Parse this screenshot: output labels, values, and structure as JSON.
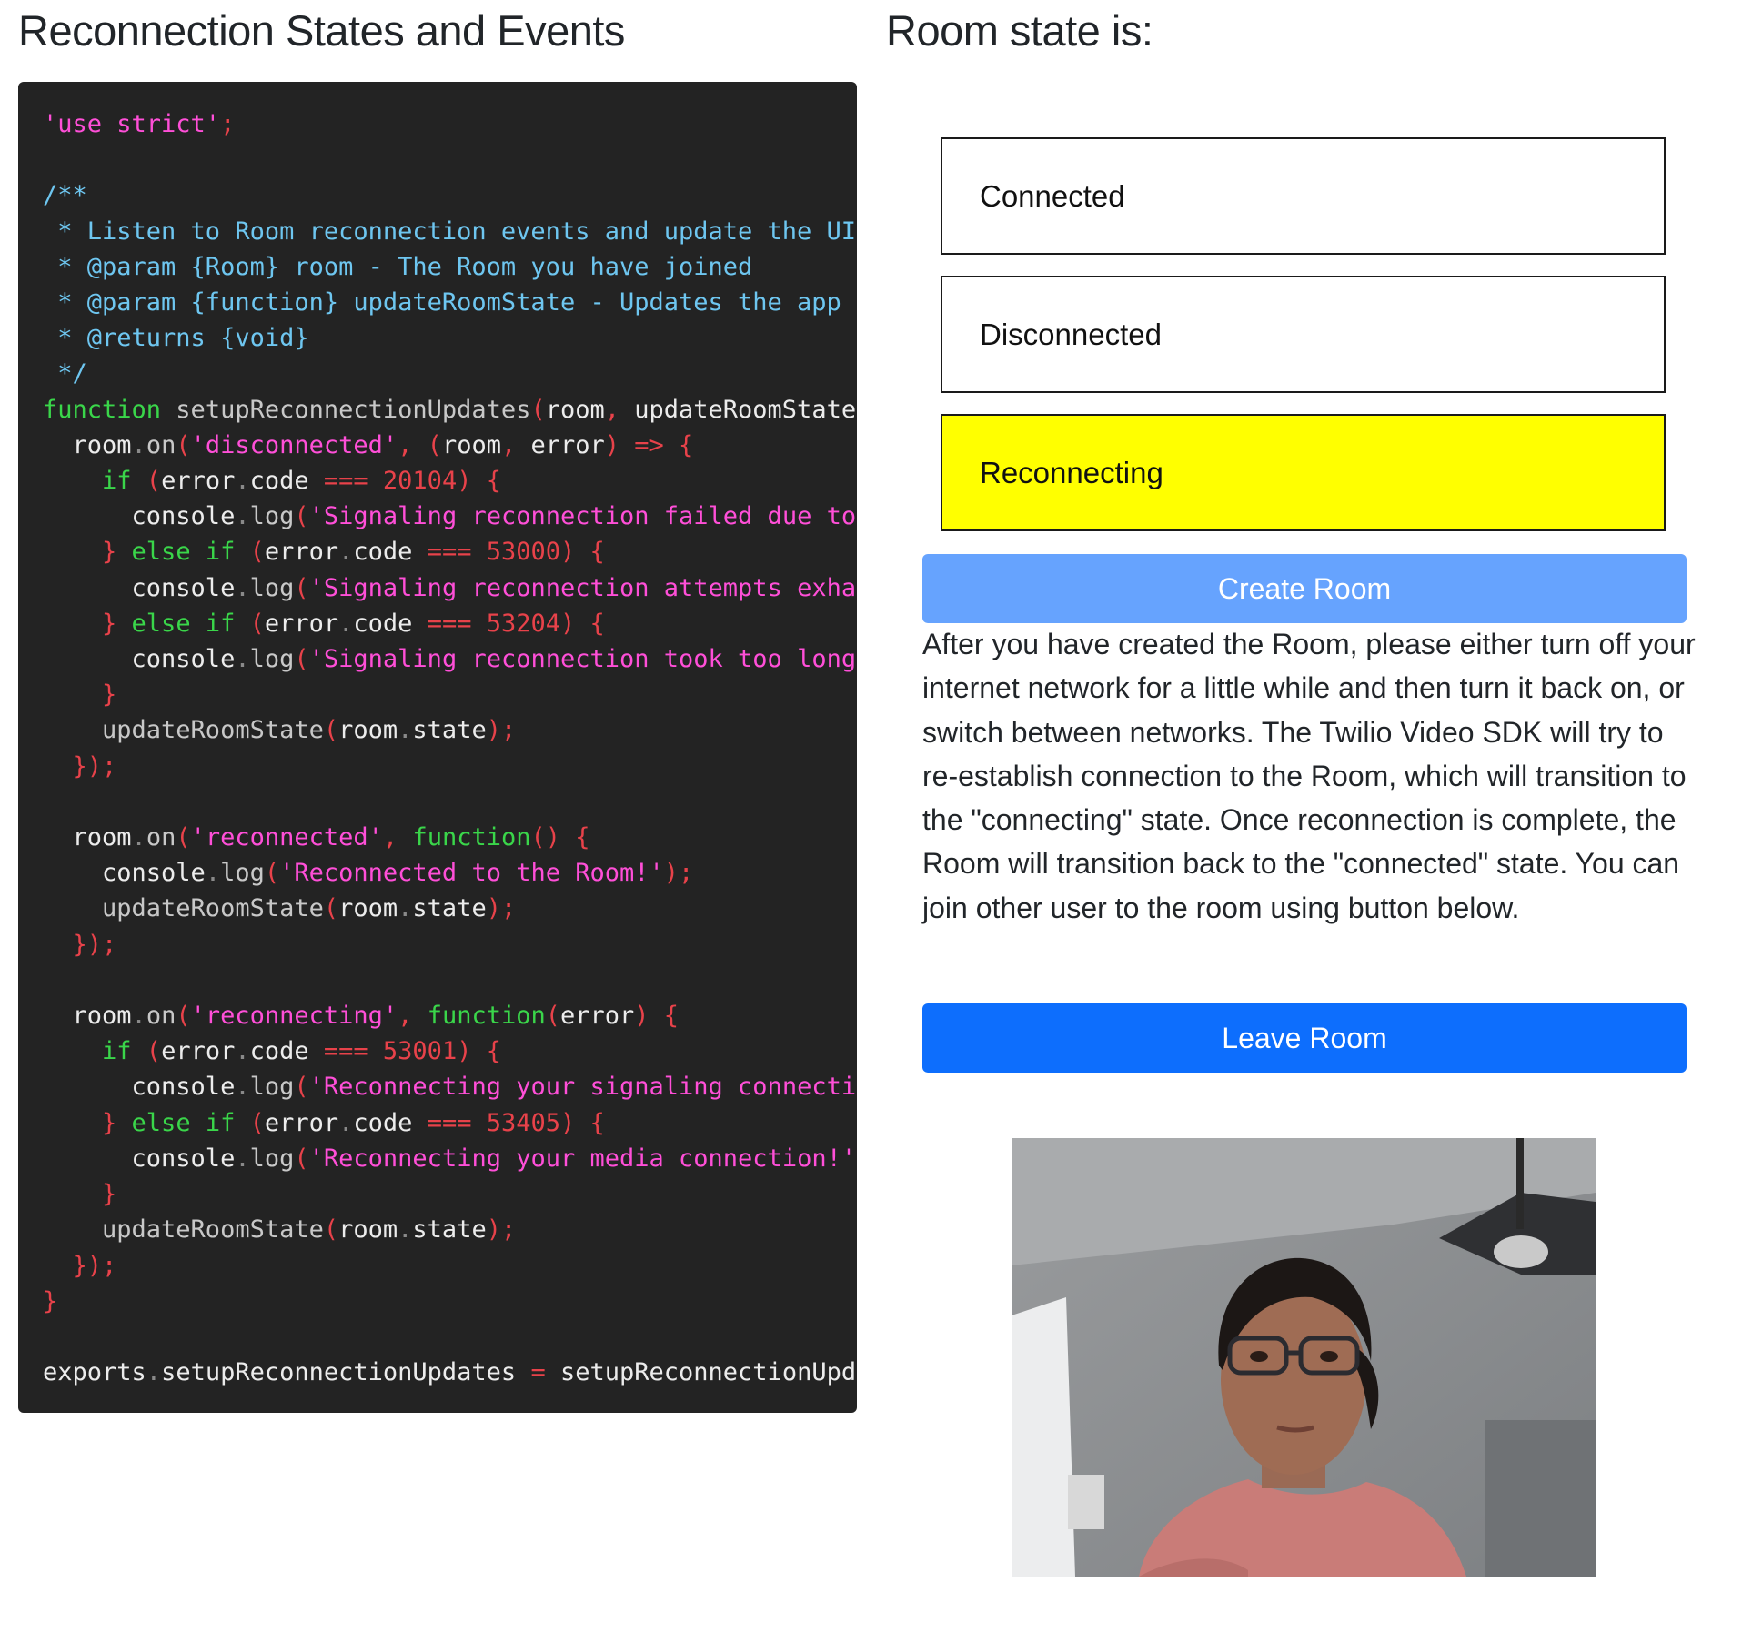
{
  "page": {
    "left_title": "Reconnection States and Events",
    "right_title": "Room state is:"
  },
  "code": {
    "lines": [
      [
        [
          "str",
          "'use strict'"
        ],
        [
          "pn",
          ";"
        ]
      ],
      [],
      [
        [
          "cm",
          "/**"
        ]
      ],
      [
        [
          "cm",
          " * Listen to Room reconnection events and update the UI a"
        ]
      ],
      [
        [
          "cm",
          " * @param {Room} room - The Room you have joined"
        ]
      ],
      [
        [
          "cm",
          " * @param {function} updateRoomState - Updates the app UI"
        ]
      ],
      [
        [
          "cm",
          " * @returns {void}"
        ]
      ],
      [
        [
          "cm",
          " */"
        ]
      ],
      [
        [
          "kw",
          "function"
        ],
        [
          "fn",
          " setupReconnectionUpdates"
        ],
        [
          "pn",
          "("
        ],
        [
          "tx",
          "room"
        ],
        [
          "pn",
          ", "
        ],
        [
          "tx",
          "updateRoomState"
        ],
        [
          "pn",
          ")"
        ]
      ],
      [
        [
          "tx",
          "  room"
        ],
        [
          "dot",
          "."
        ],
        [
          "fn",
          "on"
        ],
        [
          "pn",
          "("
        ],
        [
          "str",
          "'disconnected'"
        ],
        [
          "pn",
          ", ("
        ],
        [
          "tx",
          "room"
        ],
        [
          "pn",
          ", "
        ],
        [
          "tx",
          "error"
        ],
        [
          "pn",
          ") => {"
        ]
      ],
      [
        [
          "kw",
          "    if"
        ],
        [
          "pn",
          " ("
        ],
        [
          "tx",
          "error"
        ],
        [
          "dot",
          "."
        ],
        [
          "tx",
          "code"
        ],
        [
          "pn",
          " === 20104) {"
        ]
      ],
      [
        [
          "tx",
          "      console"
        ],
        [
          "dot",
          "."
        ],
        [
          "fn",
          "log"
        ],
        [
          "pn",
          "("
        ],
        [
          "str",
          "'Signaling reconnection failed due to e"
        ]
      ],
      [
        [
          "pn",
          "    } "
        ],
        [
          "kw",
          "else if"
        ],
        [
          "pn",
          " ("
        ],
        [
          "tx",
          "error"
        ],
        [
          "dot",
          "."
        ],
        [
          "tx",
          "code"
        ],
        [
          "pn",
          " === 53000) {"
        ]
      ],
      [
        [
          "tx",
          "      console"
        ],
        [
          "dot",
          "."
        ],
        [
          "fn",
          "log"
        ],
        [
          "pn",
          "("
        ],
        [
          "str",
          "'Signaling reconnection attempts exhaus"
        ]
      ],
      [
        [
          "pn",
          "    } "
        ],
        [
          "kw",
          "else if"
        ],
        [
          "pn",
          " ("
        ],
        [
          "tx",
          "error"
        ],
        [
          "dot",
          "."
        ],
        [
          "tx",
          "code"
        ],
        [
          "pn",
          " === 53204) {"
        ]
      ],
      [
        [
          "tx",
          "      console"
        ],
        [
          "dot",
          "."
        ],
        [
          "fn",
          "log"
        ],
        [
          "pn",
          "("
        ],
        [
          "str",
          "'Signaling reconnection took too long!'"
        ]
      ],
      [
        [
          "pn",
          "    }"
        ]
      ],
      [
        [
          "fn",
          "    updateRoomState"
        ],
        [
          "pn",
          "("
        ],
        [
          "tx",
          "room"
        ],
        [
          "dot",
          "."
        ],
        [
          "tx",
          "state"
        ],
        [
          "pn",
          ");"
        ]
      ],
      [
        [
          "pn",
          "  });"
        ]
      ],
      [],
      [
        [
          "tx",
          "  room"
        ],
        [
          "dot",
          "."
        ],
        [
          "fn",
          "on"
        ],
        [
          "pn",
          "("
        ],
        [
          "str",
          "'reconnected'"
        ],
        [
          "pn",
          ", "
        ],
        [
          "kw",
          "function"
        ],
        [
          "pn",
          "() {"
        ]
      ],
      [
        [
          "tx",
          "    console"
        ],
        [
          "dot",
          "."
        ],
        [
          "fn",
          "log"
        ],
        [
          "pn",
          "("
        ],
        [
          "str",
          "'Reconnected to the Room!'"
        ],
        [
          "pn",
          ");"
        ]
      ],
      [
        [
          "fn",
          "    updateRoomState"
        ],
        [
          "pn",
          "("
        ],
        [
          "tx",
          "room"
        ],
        [
          "dot",
          "."
        ],
        [
          "tx",
          "state"
        ],
        [
          "pn",
          ");"
        ]
      ],
      [
        [
          "pn",
          "  });"
        ]
      ],
      [],
      [
        [
          "tx",
          "  room"
        ],
        [
          "dot",
          "."
        ],
        [
          "fn",
          "on"
        ],
        [
          "pn",
          "("
        ],
        [
          "str",
          "'reconnecting'"
        ],
        [
          "pn",
          ", "
        ],
        [
          "kw",
          "function"
        ],
        [
          "pn",
          "("
        ],
        [
          "tx",
          "error"
        ],
        [
          "pn",
          ") {"
        ]
      ],
      [
        [
          "kw",
          "    if"
        ],
        [
          "pn",
          " ("
        ],
        [
          "tx",
          "error"
        ],
        [
          "dot",
          "."
        ],
        [
          "tx",
          "code"
        ],
        [
          "pn",
          " === 53001) {"
        ]
      ],
      [
        [
          "tx",
          "      console"
        ],
        [
          "dot",
          "."
        ],
        [
          "fn",
          "log"
        ],
        [
          "pn",
          "("
        ],
        [
          "str",
          "'Reconnecting your signaling connection"
        ]
      ],
      [
        [
          "pn",
          "    } "
        ],
        [
          "kw",
          "else if"
        ],
        [
          "pn",
          " ("
        ],
        [
          "tx",
          "error"
        ],
        [
          "dot",
          "."
        ],
        [
          "tx",
          "code"
        ],
        [
          "pn",
          " === 53405) {"
        ]
      ],
      [
        [
          "tx",
          "      console"
        ],
        [
          "dot",
          "."
        ],
        [
          "fn",
          "log"
        ],
        [
          "pn",
          "("
        ],
        [
          "str",
          "'Reconnecting your media connection!'"
        ],
        [
          "pn",
          ","
        ]
      ],
      [
        [
          "pn",
          "    }"
        ]
      ],
      [
        [
          "fn",
          "    updateRoomState"
        ],
        [
          "pn",
          "("
        ],
        [
          "tx",
          "room"
        ],
        [
          "dot",
          "."
        ],
        [
          "tx",
          "state"
        ],
        [
          "pn",
          ");"
        ]
      ],
      [
        [
          "pn",
          "  });"
        ]
      ],
      [
        [
          "pn",
          "}"
        ]
      ],
      [],
      [
        [
          "tx",
          "exports"
        ],
        [
          "dot",
          "."
        ],
        [
          "tx",
          "setupReconnectionUpdates"
        ],
        [
          "pn",
          " = "
        ],
        [
          "tx",
          "setupReconnectionUpdat"
        ]
      ]
    ]
  },
  "room_states": {
    "connected": "Connected",
    "disconnected": "Disconnected",
    "reconnecting": "Reconnecting",
    "active": "reconnecting"
  },
  "buttons": {
    "create": "Create Room",
    "leave": "Leave Room"
  },
  "instructions": "After you have created the Room, please either turn off your internet network for a little while and then turn it back on, or switch between networks. The Twilio Video SDK will try to re-establish connection to the Room, which will transition to the \"connecting\" state. Once reconnection is complete, the Room will transition back to the \"connected\" state. You can join other user to the room using button below.",
  "colors": {
    "code_bg": "#232323",
    "string": "#ff4fd8",
    "comment": "#6ec6f0",
    "keyword": "#3ad64a",
    "punct": "#e8424a",
    "active_state": "#ffff00",
    "create_button": "#66a3fe",
    "leave_button": "#0d6efd"
  }
}
